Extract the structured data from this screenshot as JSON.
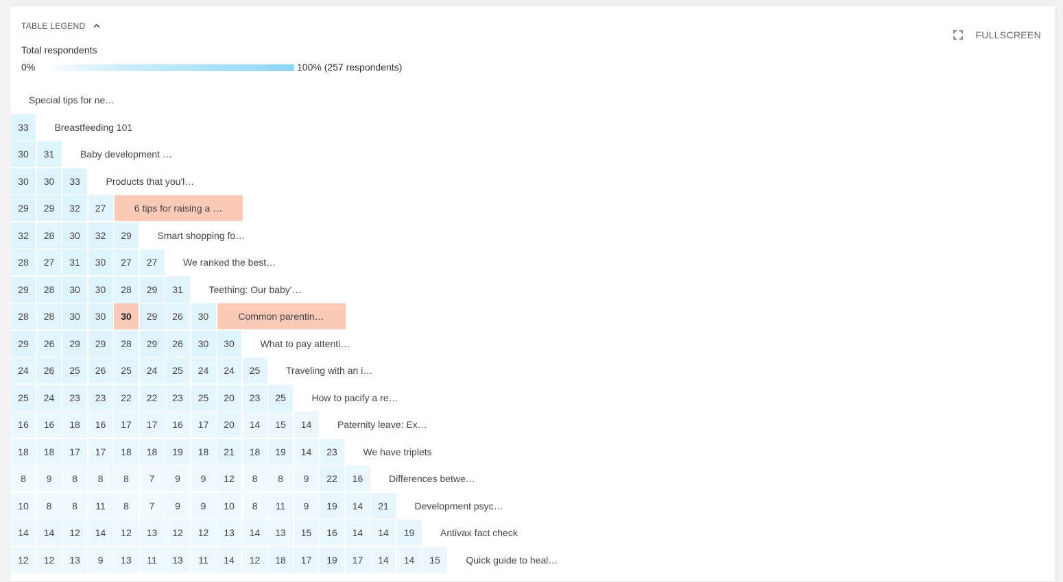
{
  "legend": {
    "toggle_label": "TABLE LEGEND",
    "toggle_icon": "chevron-up-icon"
  },
  "toolbar": {
    "fullscreen_label": "FULLSCREEN",
    "fullscreen_icon": "fullscreen-icon"
  },
  "scale": {
    "title": "Total respondents",
    "min_label": "0%",
    "max_label": "100% (257 respondents)",
    "total_respondents": 257,
    "color_low": "#ffffff",
    "color_high": "#8dd6f5"
  },
  "colors": {
    "highlight": "#fccab8",
    "card_bg": "#ffffff",
    "page_bg": "#f2f2f2"
  },
  "highlight": {
    "row": 8,
    "col": 4,
    "value": 30
  },
  "matrix": {
    "labels": [
      "Special tips for ne…",
      "Breastfeeding 101",
      "Baby development …",
      "Products that you'l…",
      "6 tips for raising a …",
      "Smart shopping fo…",
      "We ranked the best…",
      "Teething: Our baby'…",
      "Common parentin…",
      "What to pay attenti…",
      "Traveling with an i…",
      "How to pacify a re…",
      "Paternity leave: Ex…",
      "We have triplets",
      "Differences betwe…",
      "Development psyc…",
      "Antivax fact check",
      "Quick guide to heal…"
    ],
    "rows": [
      [],
      [
        33
      ],
      [
        30,
        31
      ],
      [
        30,
        30,
        33
      ],
      [
        29,
        29,
        32,
        27
      ],
      [
        32,
        28,
        30,
        32,
        29
      ],
      [
        28,
        27,
        31,
        30,
        27,
        27
      ],
      [
        29,
        28,
        30,
        30,
        28,
        29,
        31
      ],
      [
        28,
        28,
        30,
        30,
        30,
        29,
        26,
        30
      ],
      [
        29,
        26,
        29,
        29,
        28,
        29,
        26,
        30,
        30
      ],
      [
        24,
        26,
        25,
        26,
        25,
        24,
        25,
        24,
        24,
        25
      ],
      [
        25,
        24,
        23,
        23,
        22,
        22,
        23,
        25,
        20,
        23,
        25
      ],
      [
        16,
        16,
        18,
        16,
        17,
        17,
        16,
        17,
        20,
        14,
        15,
        14
      ],
      [
        18,
        18,
        17,
        17,
        18,
        18,
        19,
        18,
        21,
        18,
        19,
        14,
        23
      ],
      [
        8,
        9,
        8,
        8,
        8,
        7,
        9,
        9,
        12,
        8,
        8,
        9,
        22,
        16
      ],
      [
        10,
        8,
        8,
        11,
        8,
        7,
        9,
        9,
        10,
        8,
        11,
        9,
        19,
        14,
        21
      ],
      [
        14,
        14,
        12,
        14,
        12,
        13,
        12,
        12,
        13,
        14,
        13,
        15,
        16,
        14,
        14,
        19
      ],
      [
        12,
        12,
        13,
        9,
        13,
        11,
        13,
        11,
        14,
        12,
        18,
        17,
        19,
        17,
        14,
        14,
        15
      ]
    ]
  }
}
